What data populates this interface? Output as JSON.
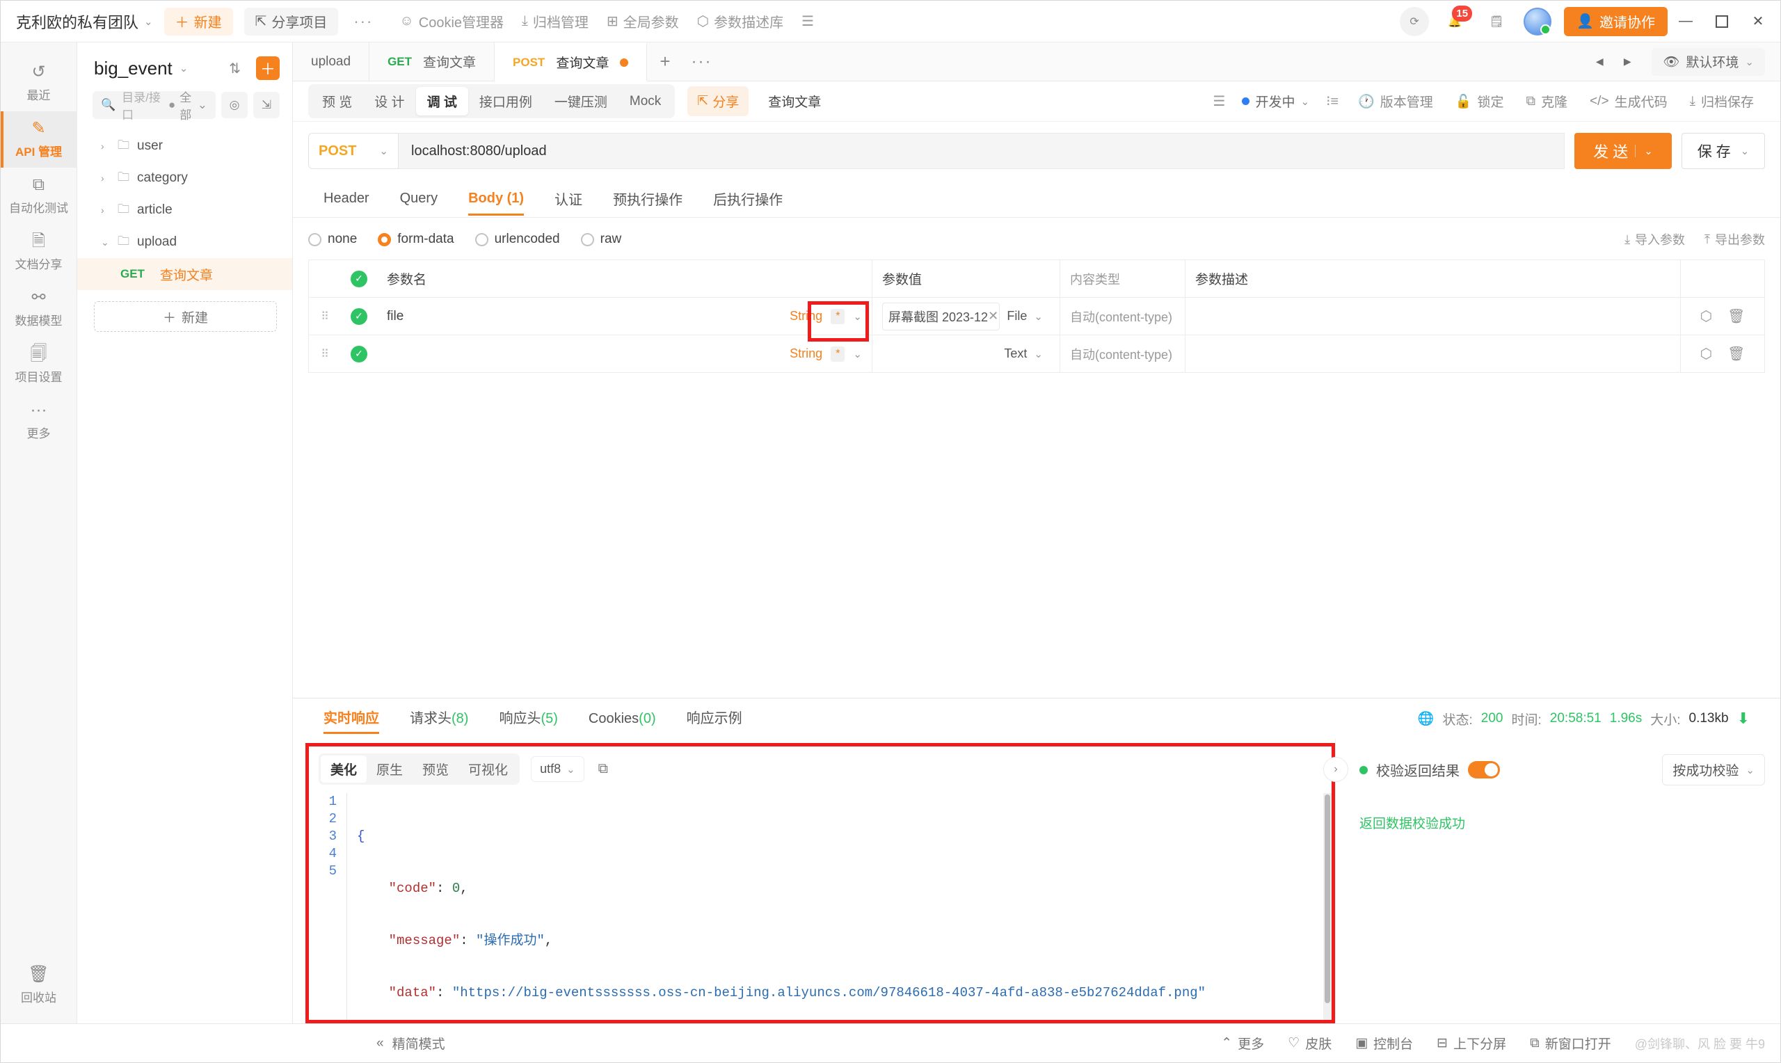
{
  "titlebar": {
    "team": "克利欧的私有团队",
    "new_label": "新建",
    "share_project": "分享项目",
    "more": "···",
    "cookie_manager": "Cookie管理器",
    "archive_manage": "归档管理",
    "global_params": "全局参数",
    "param_lib": "参数描述库",
    "notification_count": "15",
    "invite": "邀请协作",
    "minimize": "—",
    "maximize": "▫",
    "close": "✕"
  },
  "rail": {
    "items": [
      {
        "label": "最近",
        "icon": "history-icon"
      },
      {
        "label": "API 管理",
        "icon": "api-icon"
      },
      {
        "label": "自动化测试",
        "icon": "automation-icon"
      },
      {
        "label": "文档分享",
        "icon": "doc-share-icon"
      },
      {
        "label": "数据模型",
        "icon": "data-model-icon"
      },
      {
        "label": "项目设置",
        "icon": "project-settings-icon"
      },
      {
        "label": "更多",
        "icon": "more-icon"
      }
    ],
    "active_index": 1,
    "recycle": "回收站"
  },
  "tree": {
    "project": "big_event",
    "search_placeholder": "目录/接口",
    "filter": "全部",
    "nodes": [
      {
        "label": "user",
        "expanded": false
      },
      {
        "label": "category",
        "expanded": false
      },
      {
        "label": "article",
        "expanded": false
      },
      {
        "label": "upload",
        "expanded": true
      }
    ],
    "leaf": {
      "method": "GET",
      "name": "查询文章"
    },
    "new_button": "新建"
  },
  "tabs": {
    "items": [
      {
        "method": "",
        "label": "upload",
        "active": false
      },
      {
        "method": "GET",
        "label": "查询文章",
        "active": false
      },
      {
        "method": "POST",
        "label": "查询文章",
        "active": true,
        "dirty": true
      }
    ],
    "add": "+",
    "more": "···",
    "env": "默认环境"
  },
  "subbar": {
    "segments": [
      "预 览",
      "设 计",
      "调 试",
      "接口用例",
      "一键压测",
      "Mock"
    ],
    "active_segment": "调 试",
    "share": "分享",
    "doc_title": "查询文章",
    "status": "开发中",
    "right_items": [
      "版本管理",
      "锁定",
      "克隆",
      "生成代码",
      "归档保存"
    ]
  },
  "request": {
    "method": "POST",
    "url": "localhost:8080/upload",
    "send": "发 送",
    "save": "保 存",
    "tabs": [
      {
        "label": "Header",
        "active": false
      },
      {
        "label": "Query",
        "active": false
      },
      {
        "label": "Body (1)",
        "active": true
      },
      {
        "label": "认证",
        "active": false
      },
      {
        "label": "预执行操作",
        "active": false
      },
      {
        "label": "后执行操作",
        "active": false
      }
    ],
    "body_types": [
      {
        "label": "none",
        "selected": false
      },
      {
        "label": "form-data",
        "selected": true
      },
      {
        "label": "urlencoded",
        "selected": false
      },
      {
        "label": "raw",
        "selected": false
      }
    ],
    "import_params": "导入参数",
    "export_params": "导出参数",
    "table": {
      "headers": [
        "参数名",
        "参数值",
        "内容类型",
        "参数描述"
      ],
      "rows": [
        {
          "name": "file",
          "type": "String",
          "required": "*",
          "value": "屏幕截图 2023-12",
          "value_kind": "File",
          "content_type": "自动(content-type)",
          "desc": ""
        },
        {
          "name": "",
          "type": "String",
          "required": "*",
          "value": "",
          "value_kind": "Text",
          "content_type": "自动(content-type)",
          "desc": ""
        }
      ]
    }
  },
  "response": {
    "tabs": [
      {
        "label": "实时响应",
        "count": "",
        "active": true
      },
      {
        "label": "请求头",
        "count": "(8)",
        "active": false
      },
      {
        "label": "响应头",
        "count": "(5)",
        "active": false
      },
      {
        "label": "Cookies",
        "count": "(0)",
        "active": false
      },
      {
        "label": "响应示例",
        "count": "",
        "active": false
      }
    ],
    "meta": {
      "status_label": "状态:",
      "status_value": "200",
      "time_label": "时间:",
      "time_value": "20:58:51",
      "duration": "1.96s",
      "size_label": "大小:",
      "size_value": "0.13kb"
    },
    "code_tools": {
      "segments": [
        "美化",
        "原生",
        "预览",
        "可视化"
      ],
      "active": "美化",
      "encoding": "utf8",
      "copy_icon": "copy-icon"
    },
    "code_lines": [
      "1",
      "2",
      "3",
      "4",
      "5"
    ],
    "json": {
      "open": "{",
      "code_key": "\"code\"",
      "code_val": "0",
      "message_key": "\"message\"",
      "message_val": "\"操作成功\"",
      "data_key": "\"data\"",
      "data_val": "\"https://big-eventsssssss.oss-cn-beijing.aliyuncs.com/97846618-4037-4afd-a838-e5b27624ddaf.png\"",
      "close": "}"
    },
    "validation": {
      "title": "校验返回结果",
      "mode": "按成功校验",
      "result": "返回数据校验成功"
    }
  },
  "statusbar": {
    "collapse_icon": "«",
    "simple_mode": "精简模式",
    "more": "更多",
    "skin": "皮肤",
    "console": "控制台",
    "split": "上下分屏",
    "new_window": "新窗口打开",
    "watermark": "@剑锋聊、风 脸 要 牛9"
  }
}
